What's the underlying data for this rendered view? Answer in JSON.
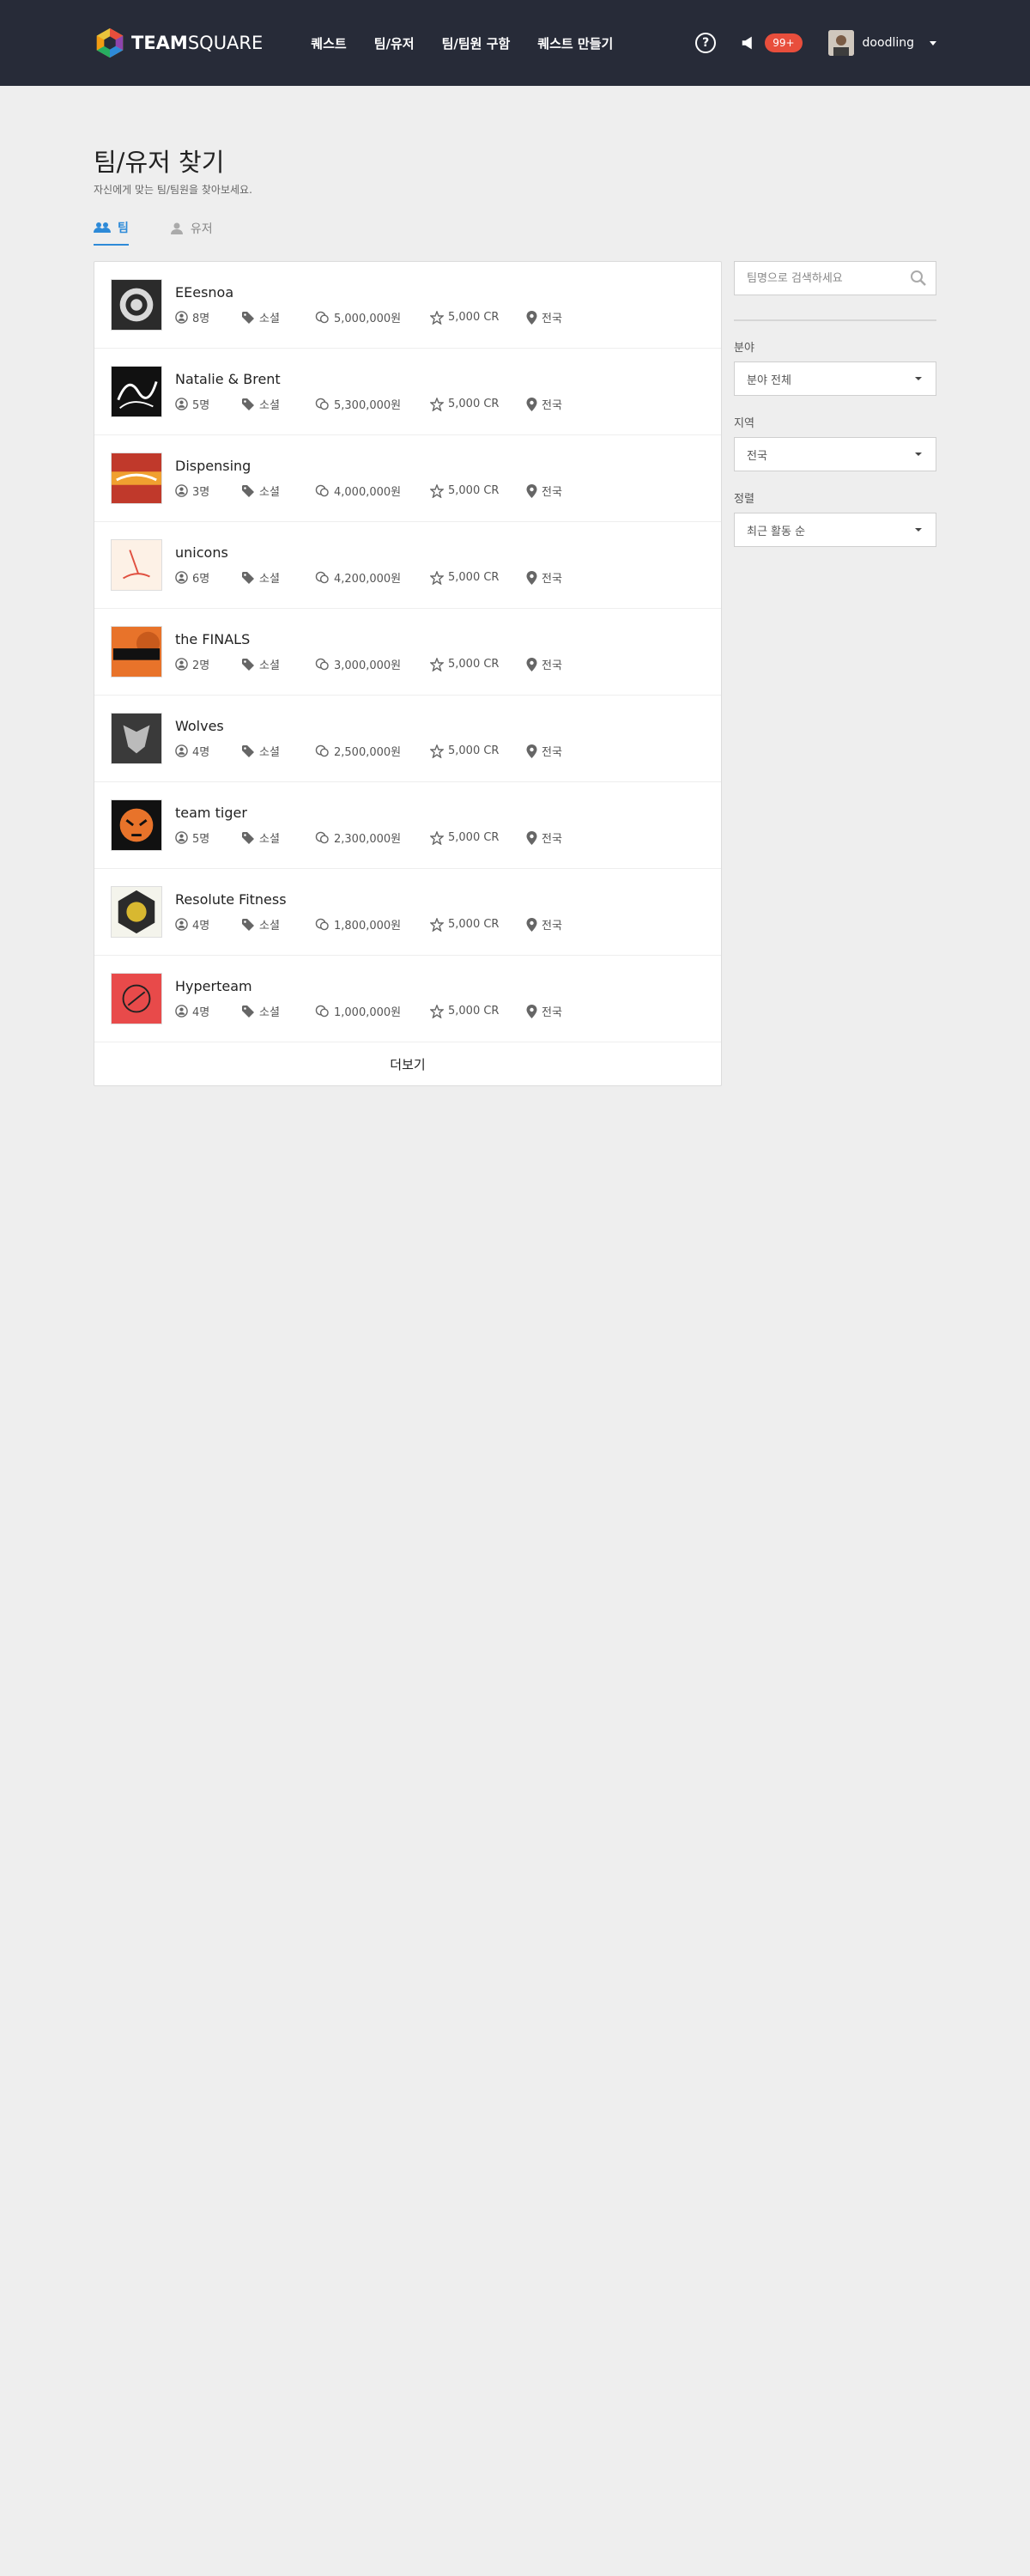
{
  "header": {
    "logo_bold": "TEAM",
    "logo_light": "SQUARE",
    "nav": [
      "퀘스트",
      "팀/유저",
      "팀/팀원 구함",
      "퀘스트 만들기"
    ],
    "help_label": "?",
    "notification_badge": "99+",
    "username": "doodling"
  },
  "page": {
    "title": "팀/유저 찾기",
    "subtitle": "자신에게 맞는 팀/팀원을 찾아보세요.",
    "tabs": [
      {
        "label": "팀",
        "active": true,
        "icon": "team-icon"
      },
      {
        "label": "유저",
        "active": false,
        "icon": "user-icon"
      }
    ]
  },
  "teams": [
    {
      "name": "EEesnoa",
      "members": "8명",
      "category": "소셜",
      "funding": "5,000,000원",
      "credit": "5,000 CR",
      "region": "전국"
    },
    {
      "name": "Natalie & Brent",
      "members": "5명",
      "category": "소셜",
      "funding": "5,300,000원",
      "credit": "5,000 CR",
      "region": "전국"
    },
    {
      "name": "Dispensing",
      "members": "3명",
      "category": "소셜",
      "funding": "4,000,000원",
      "credit": "5,000 CR",
      "region": "전국"
    },
    {
      "name": "unicons",
      "members": "6명",
      "category": "소셜",
      "funding": "4,200,000원",
      "credit": "5,000 CR",
      "region": "전국"
    },
    {
      "name": "the FINALS",
      "members": "2명",
      "category": "소셜",
      "funding": "3,000,000원",
      "credit": "5,000 CR",
      "region": "전국"
    },
    {
      "name": "Wolves",
      "members": "4명",
      "category": "소셜",
      "funding": "2,500,000원",
      "credit": "5,000 CR",
      "region": "전국"
    },
    {
      "name": "team tiger",
      "members": "5명",
      "category": "소셜",
      "funding": "2,300,000원",
      "credit": "5,000 CR",
      "region": "전국"
    },
    {
      "name": "Resolute Fitness",
      "members": "4명",
      "category": "소셜",
      "funding": "1,800,000원",
      "credit": "5,000 CR",
      "region": "전국"
    },
    {
      "name": "Hyperteam",
      "members": "4명",
      "category": "소셜",
      "funding": "1,000,000원",
      "credit": "5,000 CR",
      "region": "전국"
    }
  ],
  "more_label": "더보기",
  "sidebar": {
    "search_placeholder": "팀명으로 검색하세요",
    "filters": [
      {
        "label": "분야",
        "value": "분야 전체"
      },
      {
        "label": "지역",
        "value": "전국"
      },
      {
        "label": "정렬",
        "value": "최근 활동 순"
      }
    ]
  },
  "colors": {
    "header_bg": "#272b38",
    "accent": "#2d8ad8",
    "badge": "#e84e3c",
    "page_bg": "#eeeeee"
  }
}
